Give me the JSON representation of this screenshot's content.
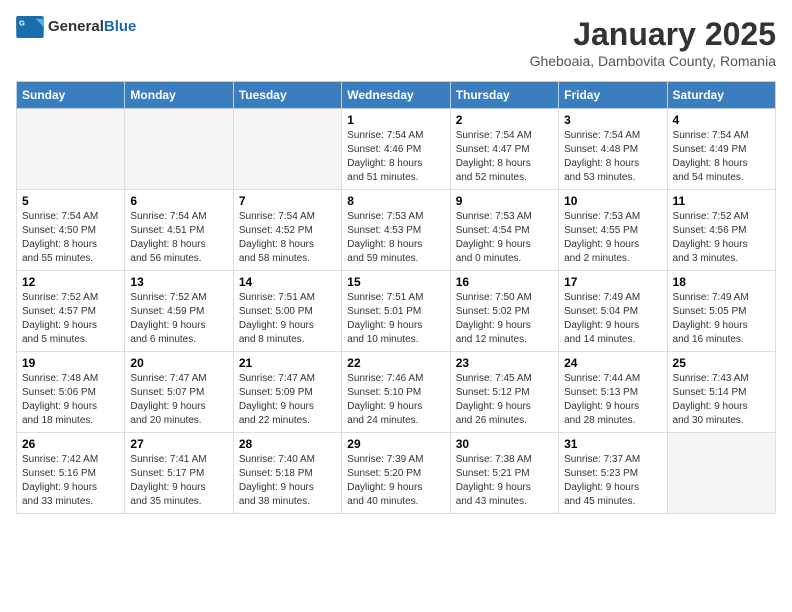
{
  "logo": {
    "general": "General",
    "blue": "Blue"
  },
  "title": "January 2025",
  "location": "Gheboaia, Dambovita County, Romania",
  "weekdays": [
    "Sunday",
    "Monday",
    "Tuesday",
    "Wednesday",
    "Thursday",
    "Friday",
    "Saturday"
  ],
  "weeks": [
    [
      {
        "day": "",
        "info": ""
      },
      {
        "day": "",
        "info": ""
      },
      {
        "day": "",
        "info": ""
      },
      {
        "day": "1",
        "info": "Sunrise: 7:54 AM\nSunset: 4:46 PM\nDaylight: 8 hours\nand 51 minutes."
      },
      {
        "day": "2",
        "info": "Sunrise: 7:54 AM\nSunset: 4:47 PM\nDaylight: 8 hours\nand 52 minutes."
      },
      {
        "day": "3",
        "info": "Sunrise: 7:54 AM\nSunset: 4:48 PM\nDaylight: 8 hours\nand 53 minutes."
      },
      {
        "day": "4",
        "info": "Sunrise: 7:54 AM\nSunset: 4:49 PM\nDaylight: 8 hours\nand 54 minutes."
      }
    ],
    [
      {
        "day": "5",
        "info": "Sunrise: 7:54 AM\nSunset: 4:50 PM\nDaylight: 8 hours\nand 55 minutes."
      },
      {
        "day": "6",
        "info": "Sunrise: 7:54 AM\nSunset: 4:51 PM\nDaylight: 8 hours\nand 56 minutes."
      },
      {
        "day": "7",
        "info": "Sunrise: 7:54 AM\nSunset: 4:52 PM\nDaylight: 8 hours\nand 58 minutes."
      },
      {
        "day": "8",
        "info": "Sunrise: 7:53 AM\nSunset: 4:53 PM\nDaylight: 8 hours\nand 59 minutes."
      },
      {
        "day": "9",
        "info": "Sunrise: 7:53 AM\nSunset: 4:54 PM\nDaylight: 9 hours\nand 0 minutes."
      },
      {
        "day": "10",
        "info": "Sunrise: 7:53 AM\nSunset: 4:55 PM\nDaylight: 9 hours\nand 2 minutes."
      },
      {
        "day": "11",
        "info": "Sunrise: 7:52 AM\nSunset: 4:56 PM\nDaylight: 9 hours\nand 3 minutes."
      }
    ],
    [
      {
        "day": "12",
        "info": "Sunrise: 7:52 AM\nSunset: 4:57 PM\nDaylight: 9 hours\nand 5 minutes."
      },
      {
        "day": "13",
        "info": "Sunrise: 7:52 AM\nSunset: 4:59 PM\nDaylight: 9 hours\nand 6 minutes."
      },
      {
        "day": "14",
        "info": "Sunrise: 7:51 AM\nSunset: 5:00 PM\nDaylight: 9 hours\nand 8 minutes."
      },
      {
        "day": "15",
        "info": "Sunrise: 7:51 AM\nSunset: 5:01 PM\nDaylight: 9 hours\nand 10 minutes."
      },
      {
        "day": "16",
        "info": "Sunrise: 7:50 AM\nSunset: 5:02 PM\nDaylight: 9 hours\nand 12 minutes."
      },
      {
        "day": "17",
        "info": "Sunrise: 7:49 AM\nSunset: 5:04 PM\nDaylight: 9 hours\nand 14 minutes."
      },
      {
        "day": "18",
        "info": "Sunrise: 7:49 AM\nSunset: 5:05 PM\nDaylight: 9 hours\nand 16 minutes."
      }
    ],
    [
      {
        "day": "19",
        "info": "Sunrise: 7:48 AM\nSunset: 5:06 PM\nDaylight: 9 hours\nand 18 minutes."
      },
      {
        "day": "20",
        "info": "Sunrise: 7:47 AM\nSunset: 5:07 PM\nDaylight: 9 hours\nand 20 minutes."
      },
      {
        "day": "21",
        "info": "Sunrise: 7:47 AM\nSunset: 5:09 PM\nDaylight: 9 hours\nand 22 minutes."
      },
      {
        "day": "22",
        "info": "Sunrise: 7:46 AM\nSunset: 5:10 PM\nDaylight: 9 hours\nand 24 minutes."
      },
      {
        "day": "23",
        "info": "Sunrise: 7:45 AM\nSunset: 5:12 PM\nDaylight: 9 hours\nand 26 minutes."
      },
      {
        "day": "24",
        "info": "Sunrise: 7:44 AM\nSunset: 5:13 PM\nDaylight: 9 hours\nand 28 minutes."
      },
      {
        "day": "25",
        "info": "Sunrise: 7:43 AM\nSunset: 5:14 PM\nDaylight: 9 hours\nand 30 minutes."
      }
    ],
    [
      {
        "day": "26",
        "info": "Sunrise: 7:42 AM\nSunset: 5:16 PM\nDaylight: 9 hours\nand 33 minutes."
      },
      {
        "day": "27",
        "info": "Sunrise: 7:41 AM\nSunset: 5:17 PM\nDaylight: 9 hours\nand 35 minutes."
      },
      {
        "day": "28",
        "info": "Sunrise: 7:40 AM\nSunset: 5:18 PM\nDaylight: 9 hours\nand 38 minutes."
      },
      {
        "day": "29",
        "info": "Sunrise: 7:39 AM\nSunset: 5:20 PM\nDaylight: 9 hours\nand 40 minutes."
      },
      {
        "day": "30",
        "info": "Sunrise: 7:38 AM\nSunset: 5:21 PM\nDaylight: 9 hours\nand 43 minutes."
      },
      {
        "day": "31",
        "info": "Sunrise: 7:37 AM\nSunset: 5:23 PM\nDaylight: 9 hours\nand 45 minutes."
      },
      {
        "day": "",
        "info": ""
      }
    ]
  ]
}
